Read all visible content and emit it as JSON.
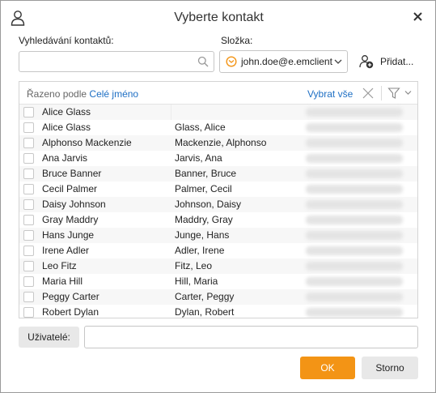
{
  "dialog": {
    "title": "Vyberte kontakt",
    "icons": {
      "title": "user-icon",
      "close": "close-icon"
    }
  },
  "search": {
    "label": "Vyhledávání kontaktů:",
    "value": "",
    "placeholder": "",
    "icon": "search-icon"
  },
  "folder": {
    "label": "Složka:",
    "selected": "john.doe@e.emclient",
    "icon": "mail-folder-icon",
    "chevron_icon": "chevron-down-icon"
  },
  "add_button": {
    "label": "Přidat...",
    "icon": "add-user-icon"
  },
  "list": {
    "sorted_by_prefix": "Řazeno podle",
    "sorted_by_field": "Celé jméno",
    "select_all": "Vybrat vše",
    "icons": {
      "clear": "clear-x-icon",
      "filter": "filter-icon",
      "filter_menu": "chevron-down-icon"
    },
    "rows": [
      {
        "name": "Alice Glass",
        "sort_name": ""
      },
      {
        "name": "Alice Glass",
        "sort_name": "Glass, Alice"
      },
      {
        "name": "Alphonso Mackenzie",
        "sort_name": "Mackenzie, Alphonso"
      },
      {
        "name": "Ana Jarvis",
        "sort_name": "Jarvis, Ana"
      },
      {
        "name": "Bruce Banner",
        "sort_name": "Banner, Bruce"
      },
      {
        "name": "Cecil Palmer",
        "sort_name": "Palmer, Cecil"
      },
      {
        "name": "Daisy Johnson",
        "sort_name": "Johnson, Daisy"
      },
      {
        "name": "Gray Maddry",
        "sort_name": "Maddry, Gray"
      },
      {
        "name": "Hans Junge",
        "sort_name": "Junge, Hans"
      },
      {
        "name": "Irene Adler",
        "sort_name": "Adler, Irene"
      },
      {
        "name": "Leo Fitz",
        "sort_name": "Fitz, Leo"
      },
      {
        "name": "Maria Hill",
        "sort_name": "Hill, Maria"
      },
      {
        "name": "Peggy Carter",
        "sort_name": "Carter, Peggy"
      },
      {
        "name": "Robert Dylan",
        "sort_name": "Dylan, Robert"
      }
    ]
  },
  "users": {
    "button_label": "Uživatelé:",
    "value": ""
  },
  "footer": {
    "ok_label": "OK",
    "cancel_label": "Storno"
  },
  "colors": {
    "accent_link": "#1e6fc4",
    "ok_button": "#f39415",
    "folder_icon": "#f39415"
  }
}
